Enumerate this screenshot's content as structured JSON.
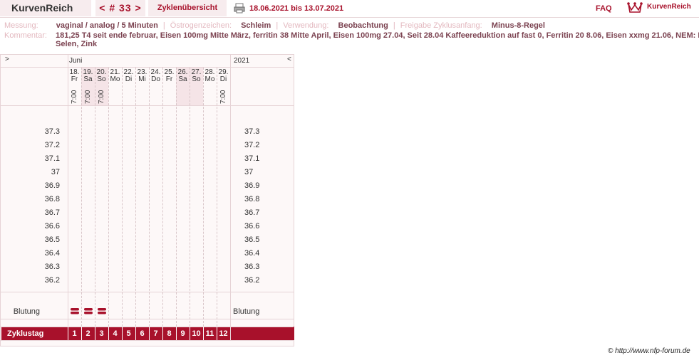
{
  "header": {
    "app_title": "KurvenReich",
    "cycle_nav": "< # 33 >",
    "overview_label": "Zyklenübersicht",
    "date_range": "18.06.2021 bis 13.07.2021",
    "faq_label": "FAQ",
    "logo_text": "KurvenReich",
    "icons": [
      "printer-icon",
      "crown-logo-icon"
    ]
  },
  "info": {
    "messung_label": "Messung:",
    "messung_value": "vaginal / analog / 5 Minuten",
    "oestrogen_label": "Östrogenzeichen:",
    "oestrogen_value": "Schleim",
    "verwendung_label": "Verwendung:",
    "verwendung_value": "Beobachtung",
    "freigabe_label": "Freigabe Zyklusanfang:",
    "freigabe_value": "Minus-8-Regel",
    "kommentar_label": "Kommentar:",
    "kommentar_line1": "181,25 T4 seit ende februar, Eisen 100mg Mitte März, ferritin 38 Mitte April, Eisen 100mg 27.04, Seit 28.04 Kaffeereduktion auf fast 0, Ferritin 20 8.06, Eisen xxmg 21.06, NEM: Folsäu",
    "kommentar_line2": "Selen, Zink"
  },
  "chart": {
    "nav_left": ">",
    "nav_right": "<",
    "month": "Juni",
    "year": "2021",
    "days": [
      {
        "d": "18.",
        "w": "Fr",
        "t": "7:00",
        "weekend": false
      },
      {
        "d": "19.",
        "w": "Sa",
        "t": "7:00",
        "weekend": true
      },
      {
        "d": "20.",
        "w": "So",
        "t": "7:00",
        "weekend": true
      },
      {
        "d": "21.",
        "w": "Mo",
        "t": "",
        "weekend": false
      },
      {
        "d": "22.",
        "w": "Di",
        "t": "",
        "weekend": false
      },
      {
        "d": "23.",
        "w": "Mi",
        "t": "",
        "weekend": false
      },
      {
        "d": "24.",
        "w": "Do",
        "t": "",
        "weekend": false
      },
      {
        "d": "25.",
        "w": "Fr",
        "t": "",
        "weekend": false
      },
      {
        "d": "26.",
        "w": "Sa",
        "t": "",
        "weekend": true
      },
      {
        "d": "27.",
        "w": "So",
        "t": "",
        "weekend": true
      },
      {
        "d": "28.",
        "w": "Mo",
        "t": "",
        "weekend": false
      },
      {
        "d": "29.",
        "w": "Di",
        "t": "7:00",
        "weekend": false
      }
    ],
    "temperature_ticks": [
      "37.3",
      "37.2",
      "37.1",
      "37",
      "36.9",
      "36.8",
      "36.7",
      "36.6",
      "36.5",
      "36.4",
      "36.3",
      "36.2"
    ],
    "blutung_label": "Blutung",
    "bleeding_days": [
      1,
      2,
      3
    ],
    "zyklustag_label": "Zyklustag",
    "cycle_days": [
      "1",
      "2",
      "3",
      "4",
      "5",
      "6",
      "7",
      "8",
      "9",
      "10",
      "11",
      "12"
    ],
    "accent_color": "#a8112b"
  },
  "footer": {
    "copyright": "© http://www.nfp-forum.de"
  }
}
